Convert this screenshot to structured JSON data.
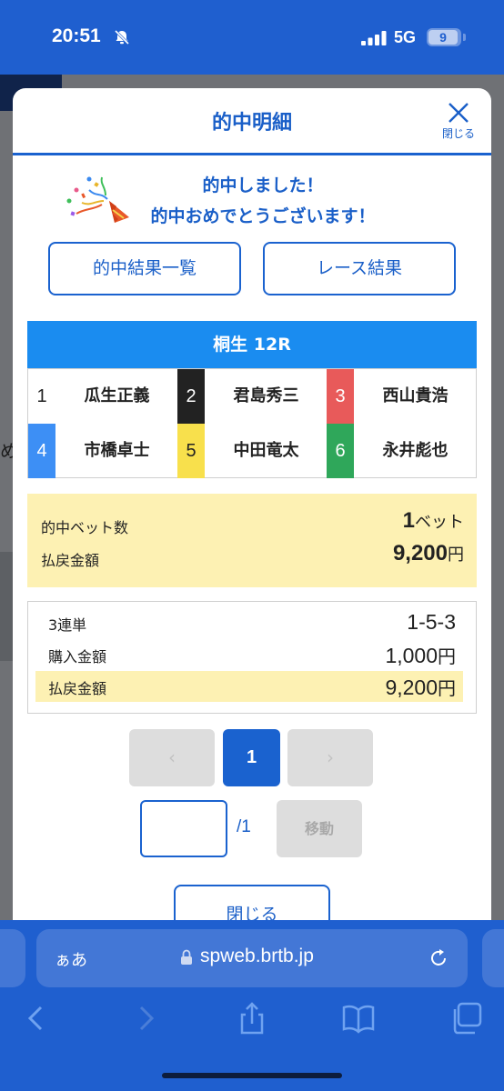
{
  "status_bar": {
    "time": "20:51",
    "network": "5G",
    "battery": "9"
  },
  "modal": {
    "title": "的中明細",
    "close_label": "閉じる",
    "message_line1": "的中しました！",
    "message_line2": "的中おめでとうございます！",
    "buttons": {
      "results_list": "的中結果一覧",
      "race_results": "レース結果"
    },
    "race": {
      "title": "桐生 12R"
    },
    "racers": [
      {
        "number": "1",
        "name": "瓜生正義",
        "color": "#ffffff",
        "text_color": "#222222"
      },
      {
        "number": "2",
        "name": "君島秀三",
        "color": "#222222",
        "text_color": "#ffffff"
      },
      {
        "number": "3",
        "name": "西山貴浩",
        "color": "#e85a5a",
        "text_color": "#ffffff"
      },
      {
        "number": "4",
        "name": "市橋卓士",
        "color": "#3d8ff5",
        "text_color": "#ffffff"
      },
      {
        "number": "5",
        "name": "中田竜太",
        "color": "#f8e04c",
        "text_color": "#222222"
      },
      {
        "number": "6",
        "name": "永井彪也",
        "color": "#2fa75a",
        "text_color": "#ffffff"
      }
    ],
    "summary": {
      "hit_bets_label": "的中ベット数",
      "hit_bets_count": "1",
      "hit_bets_unit": "ベット",
      "payout_label": "払戻金額",
      "payout_amount": "9,200",
      "payout_unit": "円"
    },
    "detail": {
      "bet_type": "3連単",
      "combination": "1-5-3",
      "purchase_label": "購入金額",
      "purchase_amount": "1,000",
      "purchase_unit": "円",
      "payout_label": "払戻金額",
      "payout_amount": "9,200",
      "payout_unit": "円"
    },
    "pager": {
      "prev": "‹",
      "current": "1",
      "next": "›",
      "total": "/1",
      "move_label": "移動",
      "page_input_value": ""
    },
    "close_button": "閉じる"
  },
  "backdrop": {
    "partial_text": "め"
  },
  "browser": {
    "aa_label": "ぁあ",
    "url": "spweb.brtb.jp"
  },
  "colors": {
    "primary": "#1a62cf",
    "highlight": "#fdf1b3",
    "race_header": "#1a8cf0",
    "chrome": "#1f5fcf"
  }
}
